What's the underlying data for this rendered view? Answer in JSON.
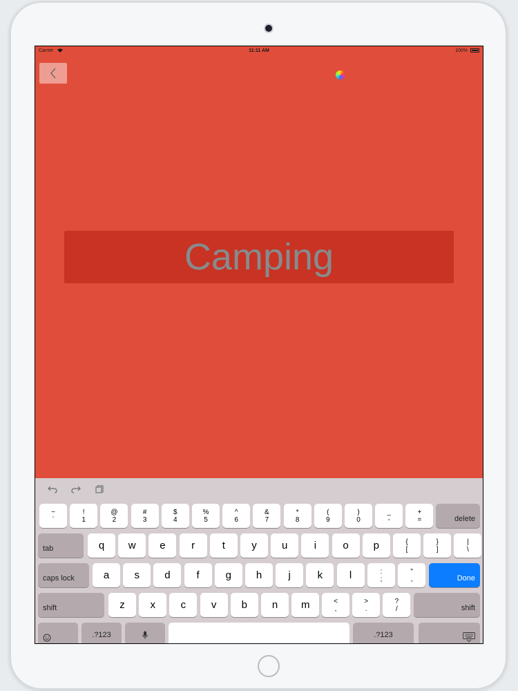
{
  "status_bar": {
    "carrier": "Carrier",
    "time": "11:11 AM",
    "battery": "100%"
  },
  "title_field": {
    "value": "Camping"
  },
  "colors": {
    "background": "#e04e3b",
    "title_field": "#c83323",
    "title_text": "#878b8e",
    "keyboard": "#d5cdd0",
    "done_key": "#0b7dfe"
  },
  "icons": {
    "back": "chevron-left-icon",
    "color_picker": "color-wheel-icon",
    "undo": "undo-icon",
    "redo": "redo-icon",
    "paste": "paste-icon",
    "emoji": "emoji-icon",
    "dictation": "microphone-icon",
    "hide_keyboard": "keyboard-icon"
  },
  "keyboard": {
    "number_row": [
      {
        "top": "~",
        "bottom": "`"
      },
      {
        "top": "!",
        "bottom": "1"
      },
      {
        "top": "@",
        "bottom": "2"
      },
      {
        "top": "#",
        "bottom": "3"
      },
      {
        "top": "$",
        "bottom": "4"
      },
      {
        "top": "%",
        "bottom": "5"
      },
      {
        "top": "^",
        "bottom": "6"
      },
      {
        "top": "&",
        "bottom": "7"
      },
      {
        "top": "*",
        "bottom": "8"
      },
      {
        "top": "(",
        "bottom": "9"
      },
      {
        "top": ")",
        "bottom": "0"
      },
      {
        "top": "_",
        "bottom": "-"
      },
      {
        "top": "+",
        "bottom": "="
      }
    ],
    "delete_label": "delete",
    "tab_label": "tab",
    "qwerty_row": [
      "q",
      "w",
      "e",
      "r",
      "t",
      "y",
      "u",
      "i",
      "o",
      "p"
    ],
    "qwerty_punct": [
      {
        "top": "{",
        "bottom": "["
      },
      {
        "top": "}",
        "bottom": "]"
      },
      {
        "top": "|",
        "bottom": "\\"
      }
    ],
    "caps_label": "caps lock",
    "home_row": [
      "a",
      "s",
      "d",
      "f",
      "g",
      "h",
      "j",
      "k",
      "l"
    ],
    "home_punct": [
      {
        "top": ":",
        "bottom": ";"
      },
      {
        "top": "\"",
        "bottom": ","
      }
    ],
    "done_label": "Done",
    "shift_label": "shift",
    "bottom_letters": [
      "z",
      "x",
      "c",
      "v",
      "b",
      "n",
      "m"
    ],
    "bottom_punct": [
      {
        "top": "<",
        "bottom": ","
      },
      {
        "top": ">",
        "bottom": "."
      },
      {
        "top": "?",
        "bottom": "/"
      }
    ],
    "numbers_label": ".?123",
    "space_label": ""
  }
}
